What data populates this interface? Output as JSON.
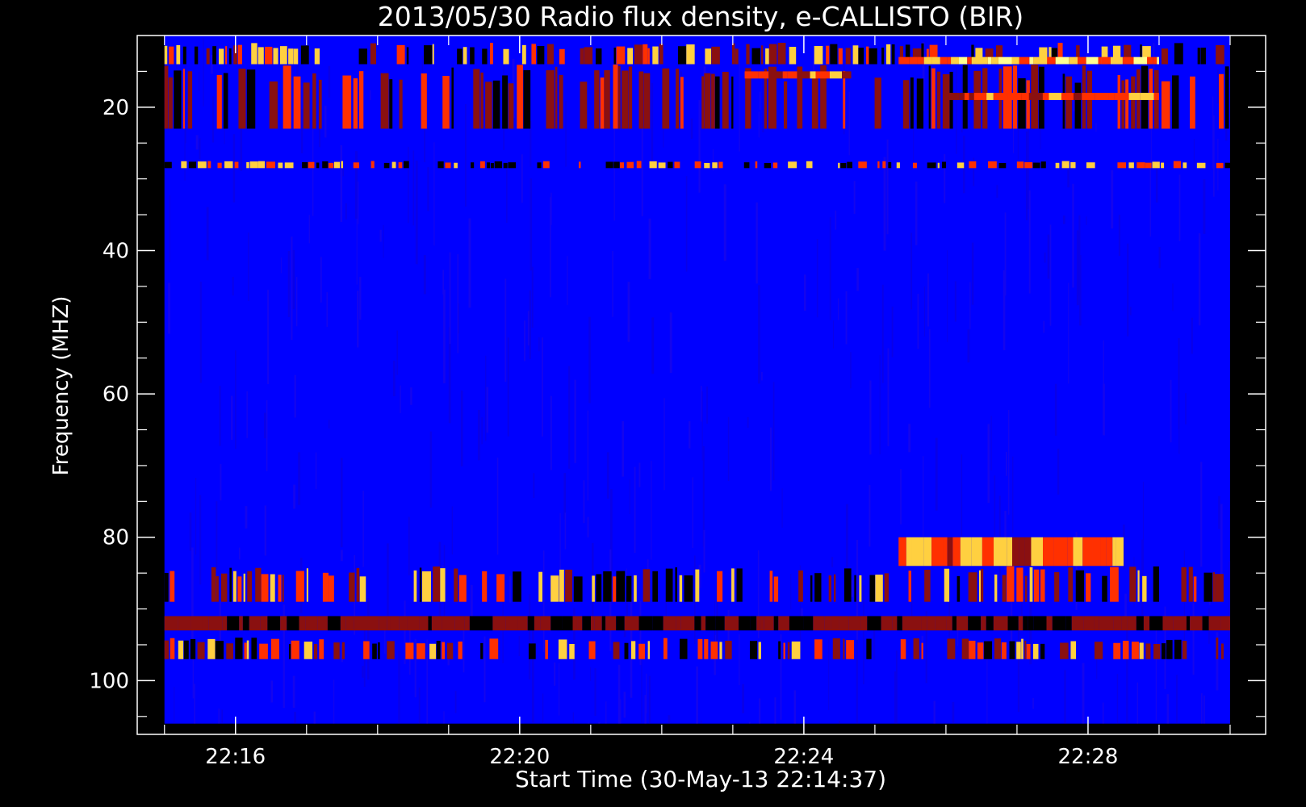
{
  "chart_data": {
    "type": "heatmap",
    "title": "2013/05/30  Radio flux density, e-CALLISTO (BIR)",
    "xlabel": "Start Time (30-May-13 22:14:37)",
    "ylabel": "Frequency (MHZ)",
    "x_tick_labels": [
      "22:16",
      "22:20",
      "22:24",
      "22:28"
    ],
    "x_ticks_min": [
      15,
      16,
      20,
      24,
      28,
      30
    ],
    "y_tick_labels": [
      "20",
      "40",
      "60",
      "80",
      "100"
    ],
    "y_ticks": [
      20,
      40,
      60,
      80,
      100
    ],
    "xlim": [
      "22:14:37",
      "22:30:30"
    ],
    "data_x_range": [
      "22:15:00",
      "22:30:00"
    ],
    "ylim": [
      107.5,
      10
    ],
    "data_y_range": [
      106,
      10
    ],
    "y_axis_inverted": true,
    "grid": false,
    "legend": "none",
    "colors": {
      "background": "#000000",
      "axes": "#ffffff",
      "low": "#0000ff",
      "mid": "#8a1010",
      "high": "#ff3000",
      "peak": "#ffd040",
      "dropout": "#000000"
    },
    "features": [
      {
        "kind": "band",
        "f_min": 11,
        "f_max": 14,
        "t_start": "22:15:00",
        "t_end": "22:30:00",
        "intensity": "high-intermittent"
      },
      {
        "kind": "band",
        "f_min": 14,
        "f_max": 23,
        "t_start": "22:15:00",
        "t_end": "22:30:00",
        "intensity": "mid-intermittent"
      },
      {
        "kind": "band",
        "f_min": 15,
        "f_max": 16,
        "t_start": "22:23:10",
        "t_end": "22:24:40",
        "intensity": "high"
      },
      {
        "kind": "band",
        "f_min": 13,
        "f_max": 14,
        "t_start": "22:25:20",
        "t_end": "22:29:00",
        "intensity": "peak"
      },
      {
        "kind": "band",
        "f_min": 18,
        "f_max": 19,
        "t_start": "22:26:00",
        "t_end": "22:29:00",
        "intensity": "high"
      },
      {
        "kind": "band",
        "f_min": 27.5,
        "f_max": 28.5,
        "t_start": "22:15:00",
        "t_end": "22:30:00",
        "intensity": "peak-dashed"
      },
      {
        "kind": "band",
        "f_min": 80,
        "f_max": 84,
        "t_start": "22:25:20",
        "t_end": "22:28:30",
        "intensity": "high"
      },
      {
        "kind": "band",
        "f_min": 84,
        "f_max": 89,
        "t_start": "22:15:00",
        "t_end": "22:30:00",
        "intensity": "high-intermittent"
      },
      {
        "kind": "band",
        "f_min": 91,
        "f_max": 93,
        "t_start": "22:15:00",
        "t_end": "22:30:00",
        "intensity": "mid"
      },
      {
        "kind": "band",
        "f_min": 94,
        "f_max": 97,
        "t_start": "22:15:00",
        "t_end": "22:30:00",
        "intensity": "high-intermittent"
      }
    ]
  }
}
